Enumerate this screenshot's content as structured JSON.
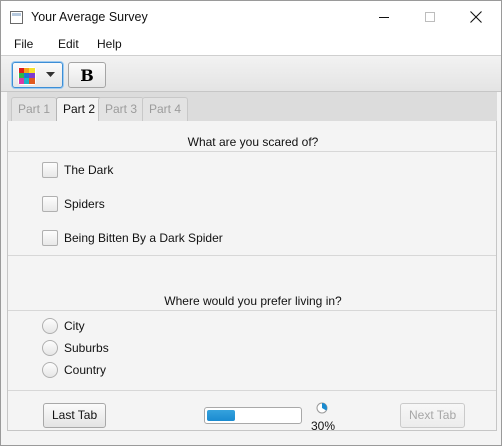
{
  "window": {
    "title": "Your Average Survey"
  },
  "menu": [
    "File",
    "Edit",
    "Help"
  ],
  "toolbar": {
    "bold_label": "B"
  },
  "tabs": [
    {
      "label": "Part 1",
      "active": false
    },
    {
      "label": "Part 2",
      "active": true
    },
    {
      "label": "Part 3",
      "active": false
    },
    {
      "label": "Part 4",
      "active": false
    }
  ],
  "question1": {
    "text": "What are you scared of?",
    "options": [
      "The Dark",
      "Spiders",
      "Being Bitten By a Dark Spider"
    ]
  },
  "question2": {
    "text": "Where would you prefer living in?",
    "options": [
      "City",
      "Suburbs",
      "Country"
    ]
  },
  "footer": {
    "last_tab_label": "Last Tab",
    "next_tab_label": "Next Tab",
    "progress": 0.3,
    "progress_text": "30%"
  },
  "colors": {
    "progress_fill": "#1a8bd0",
    "focus_border": "#3c8ed6"
  }
}
